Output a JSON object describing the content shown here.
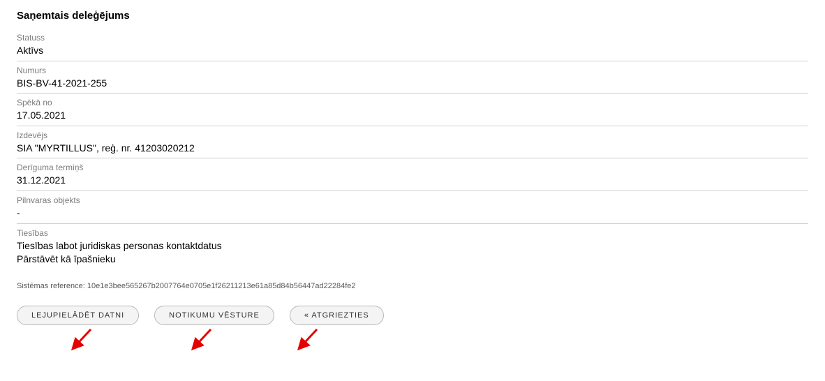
{
  "title": "Saņemtais deleģējums",
  "fields": {
    "status": {
      "label": "Statuss",
      "value": "Aktīvs"
    },
    "number": {
      "label": "Numurs",
      "value": "BIS-BV-41-2021-255"
    },
    "validFrom": {
      "label": "Spēkā no",
      "value": "17.05.2021"
    },
    "issuer": {
      "label": "Izdevējs",
      "value": "SIA \"MYRTILLUS\", reģ. nr. 41203020212"
    },
    "term": {
      "label": "Derīguma termiņš",
      "value": "31.12.2021"
    },
    "object": {
      "label": "Pilnvaras objekts",
      "value": "-"
    },
    "rights": {
      "label": "Tiesības",
      "line1": "Tiesības labot juridiskas personas kontaktdatus",
      "line2": "Pārstāvēt kā īpašnieku"
    }
  },
  "systemReference": {
    "label": "Sistēmas reference:",
    "value": "10e1e3bee565267b2007764e0705e1f26211213e61a85d84b56447ad22284fe2"
  },
  "buttons": {
    "download": "Lejupielādēt datni",
    "history": "Notikumu vēsture",
    "back": "« Atgriezties"
  }
}
